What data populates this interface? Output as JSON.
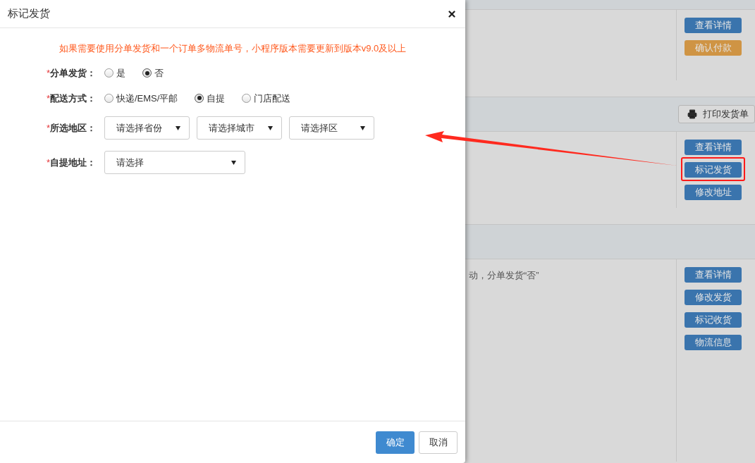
{
  "dialog": {
    "title": "标记发货",
    "notice": "如果需要使用分单发货和一个订单多物流单号，小程序版本需要更新到版本v9.0及以上",
    "fields": [
      {
        "kind": "radio",
        "mark": "*",
        "label": "分单发货：",
        "options": [
          {
            "label": "是",
            "selected": false
          },
          {
            "label": "否",
            "selected": true
          }
        ]
      },
      {
        "kind": "radio",
        "mark": "*",
        "label": "配送方式：",
        "options": [
          {
            "label": "快递/EMS/平邮",
            "selected": false
          },
          {
            "label": "自提",
            "selected": true
          },
          {
            "label": "门店配送",
            "selected": false
          }
        ]
      },
      {
        "kind": "select",
        "mark": "*",
        "label": "所选地区：",
        "selects": [
          {
            "value": "请选择省份"
          },
          {
            "value": "请选择城市"
          },
          {
            "value": "请选择区"
          }
        ]
      },
      {
        "kind": "select",
        "mark": "*",
        "label": "自提地址：",
        "selects": [
          {
            "value": "请选择"
          }
        ]
      }
    ],
    "buttons": [
      {
        "label": "确定",
        "kind": "primary"
      },
      {
        "label": "取消",
        "kind": "default"
      }
    ]
  },
  "orders": [
    {
      "actions": [
        {
          "label": "查看详情",
          "color": "#3a74ad",
          "annotated": false
        },
        {
          "label": "确认付款",
          "color": "#cf9444",
          "annotated": false
        }
      ]
    },
    {
      "print_button": "打印发货单",
      "actions": [
        {
          "label": "查看详情",
          "color": "#3a74ad",
          "annotated": false
        },
        {
          "label": "标记发货",
          "color": "#3a74ad",
          "annotated": true
        },
        {
          "label": "修改地址",
          "color": "#3a74ad",
          "annotated": false
        }
      ]
    },
    {
      "note": "动，分单发货“否”",
      "actions": [
        {
          "label": "查看详情",
          "color": "#3a74ad",
          "annotated": false
        },
        {
          "label": "修改发货",
          "color": "#3a74ad",
          "annotated": false
        },
        {
          "label": "标记收货",
          "color": "#3a74ad",
          "annotated": false
        },
        {
          "label": "物流信息",
          "color": "#3a74ad",
          "annotated": false
        }
      ]
    }
  ]
}
